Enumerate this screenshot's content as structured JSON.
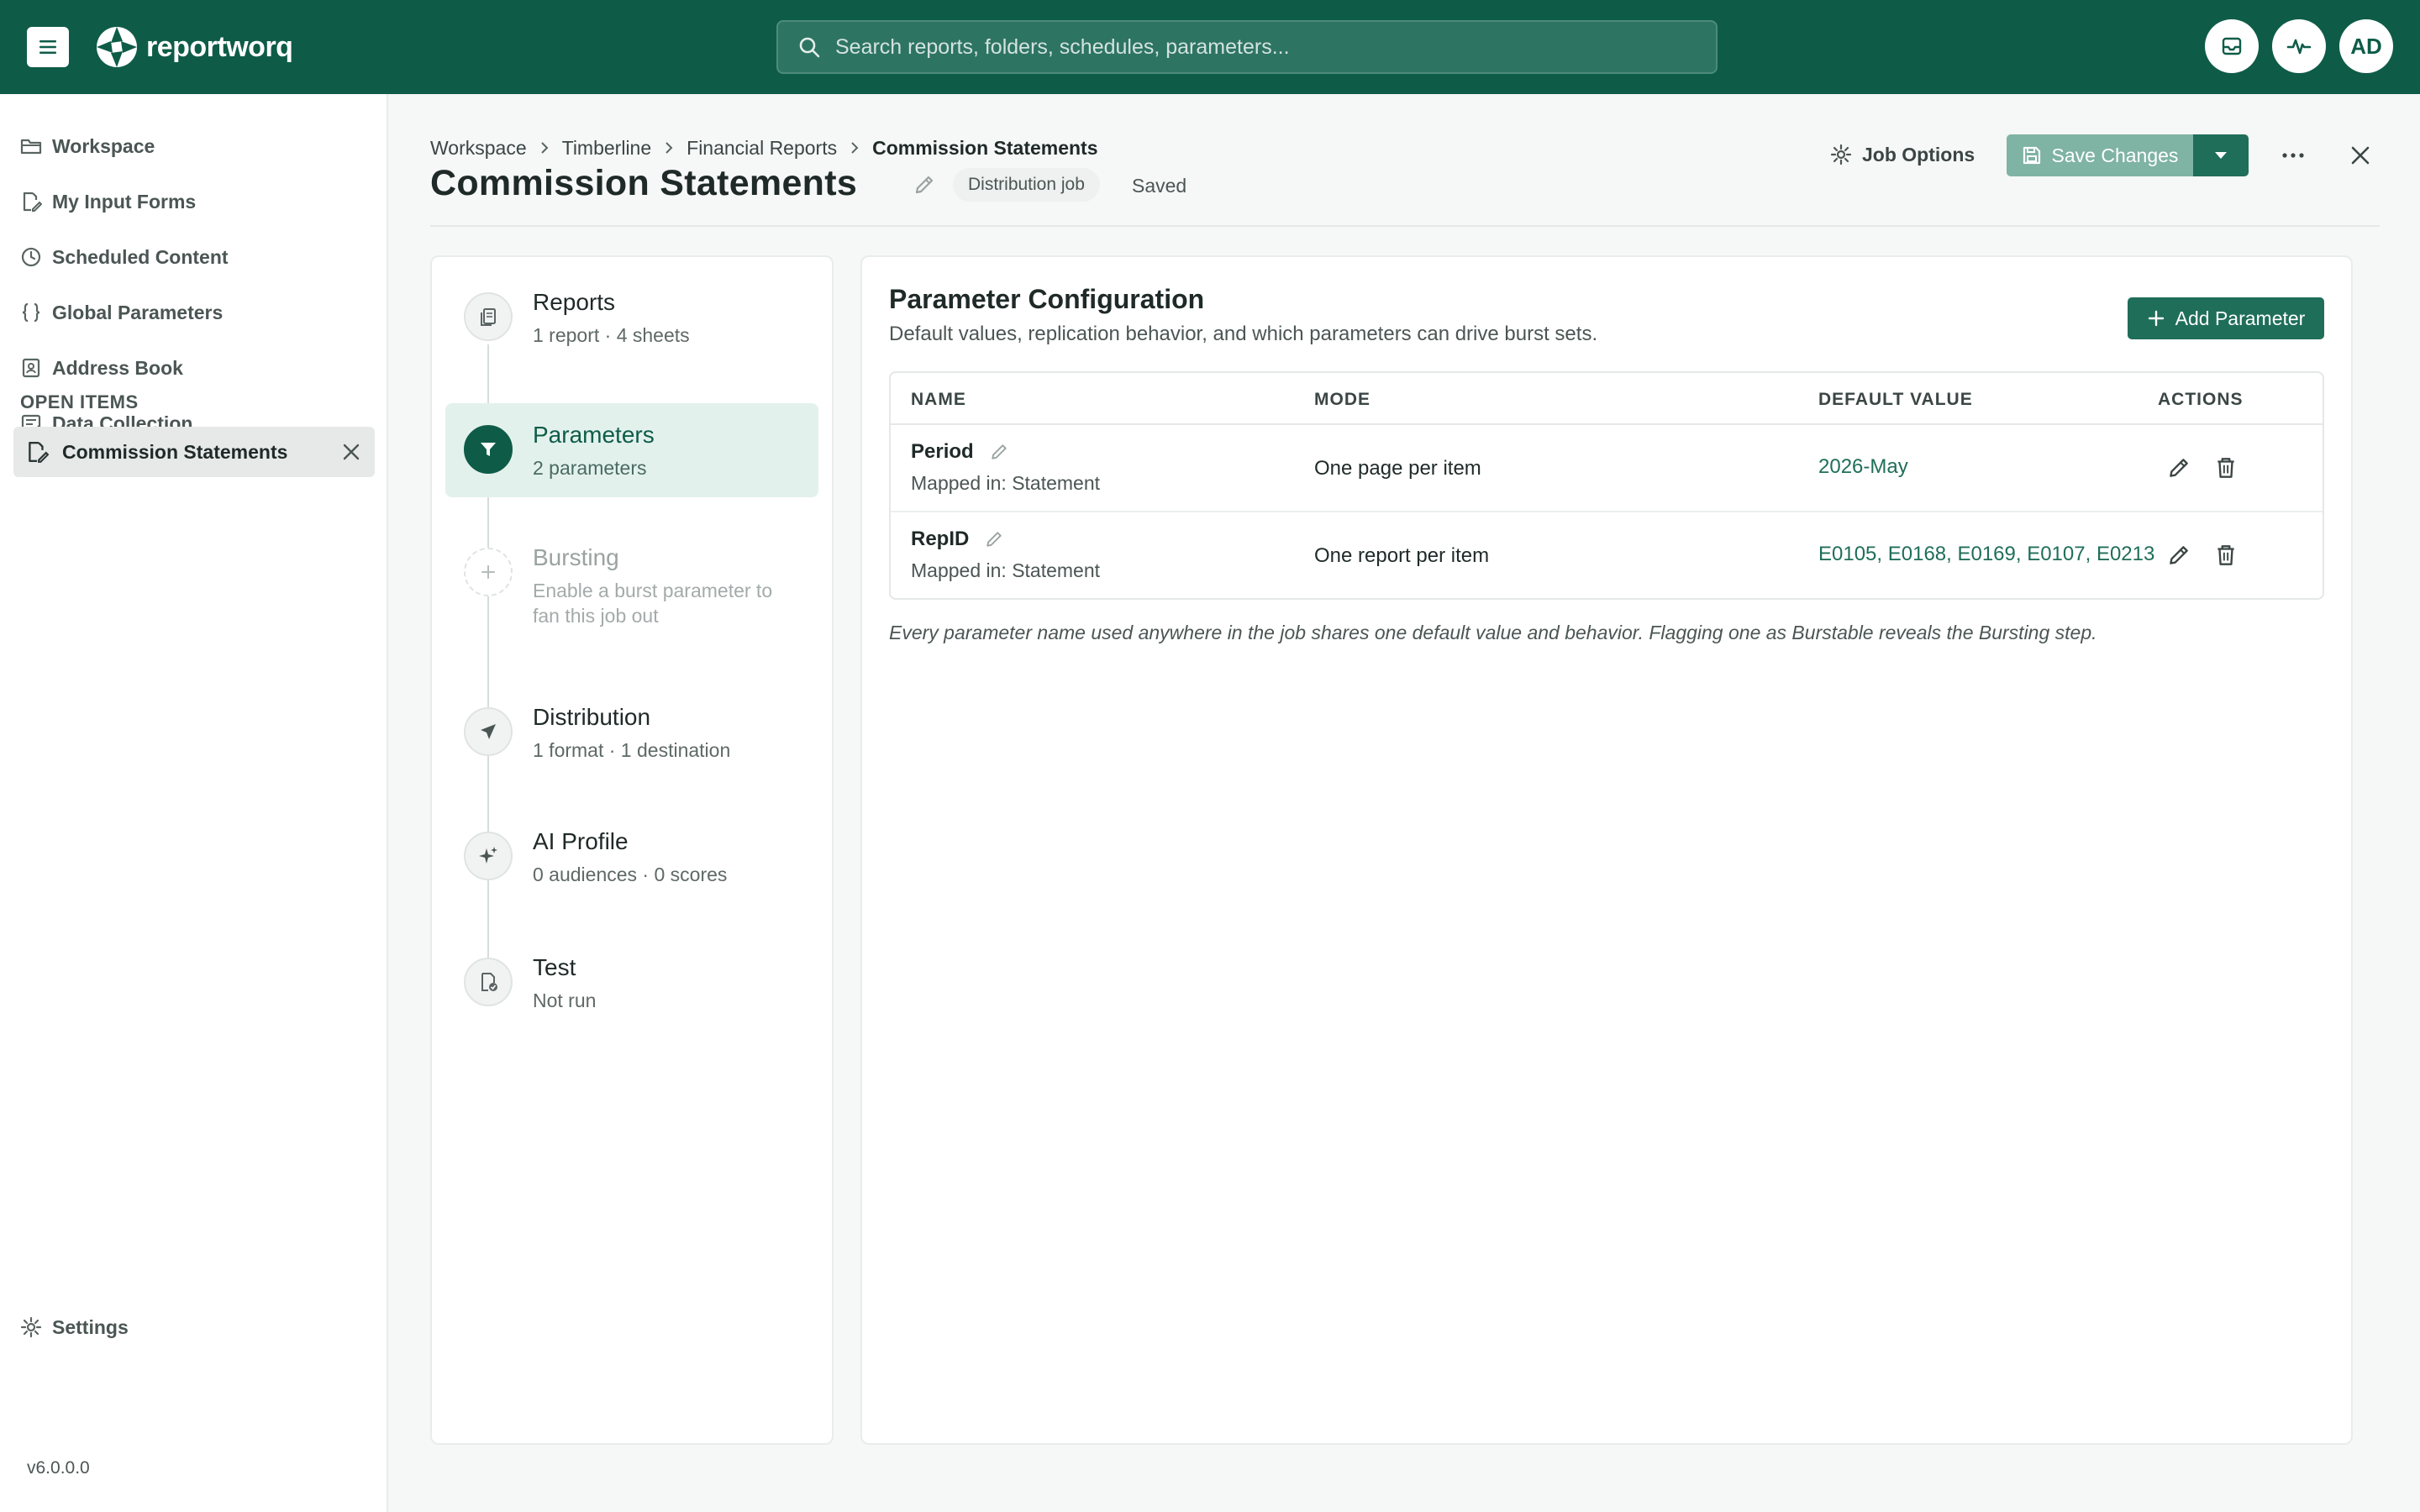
{
  "topbar": {
    "logo_text": "reportworq",
    "search_placeholder": "Search reports, folders, schedules, parameters...",
    "avatar_initials": "AD",
    "brand_color": "#0e5c48"
  },
  "sidebar": {
    "items": [
      {
        "label": "Workspace",
        "icon": "folder-icon"
      },
      {
        "label": "My Input Forms",
        "icon": "form-edit-icon"
      },
      {
        "label": "Scheduled Content",
        "icon": "clock-icon"
      },
      {
        "label": "Global Parameters",
        "icon": "braces-icon"
      },
      {
        "label": "Address Book",
        "icon": "contact-book-icon"
      },
      {
        "label": "Data Collection",
        "icon": "data-collection-icon"
      }
    ],
    "open_items_label": "OPEN ITEMS",
    "open_items": [
      {
        "label": "Commission Statements"
      }
    ],
    "settings_label": "Settings",
    "version": "v6.0.0.0"
  },
  "breadcrumb": [
    "Workspace",
    "Timberline",
    "Financial Reports",
    "Commission Statements"
  ],
  "header": {
    "title": "Commission Statements",
    "chip": "Distribution job",
    "status": "Saved",
    "job_options_label": "Job Options",
    "save_label": "Save Changes"
  },
  "steps": [
    {
      "title": "Reports",
      "subtitle": "1 report · 4 sheets",
      "state": "done"
    },
    {
      "title": "Parameters",
      "subtitle": "2 parameters",
      "state": "active"
    },
    {
      "title": "Bursting",
      "subtitle": "Enable a burst parameter to fan this job out",
      "state": "disabled"
    },
    {
      "title": "Distribution",
      "subtitle": "1 format · 1 destination",
      "state": "done"
    },
    {
      "title": "AI Profile",
      "subtitle": "0 audiences · 0 scores",
      "state": "done"
    },
    {
      "title": "Test",
      "subtitle": "Not run",
      "state": "done"
    }
  ],
  "panel": {
    "title": "Parameter Configuration",
    "subtitle": "Default values, replication behavior, and which parameters can drive burst sets.",
    "add_label": "Add Parameter",
    "columns": [
      "NAME",
      "MODE",
      "DEFAULT VALUE",
      "ACTIONS"
    ],
    "rows": [
      {
        "name": "Period",
        "mapped": "Mapped in: Statement",
        "mode": "One page per item",
        "default": "2026-May"
      },
      {
        "name": "RepID",
        "mapped": "Mapped in: Statement",
        "mode": "One report per item",
        "default": "E0105, E0168, E0169, E0107, E0213"
      }
    ],
    "footnote": "Every parameter name used anywhere in the job shares one default value and behavior. Flagging one as Burstable reveals the Bursting step."
  }
}
